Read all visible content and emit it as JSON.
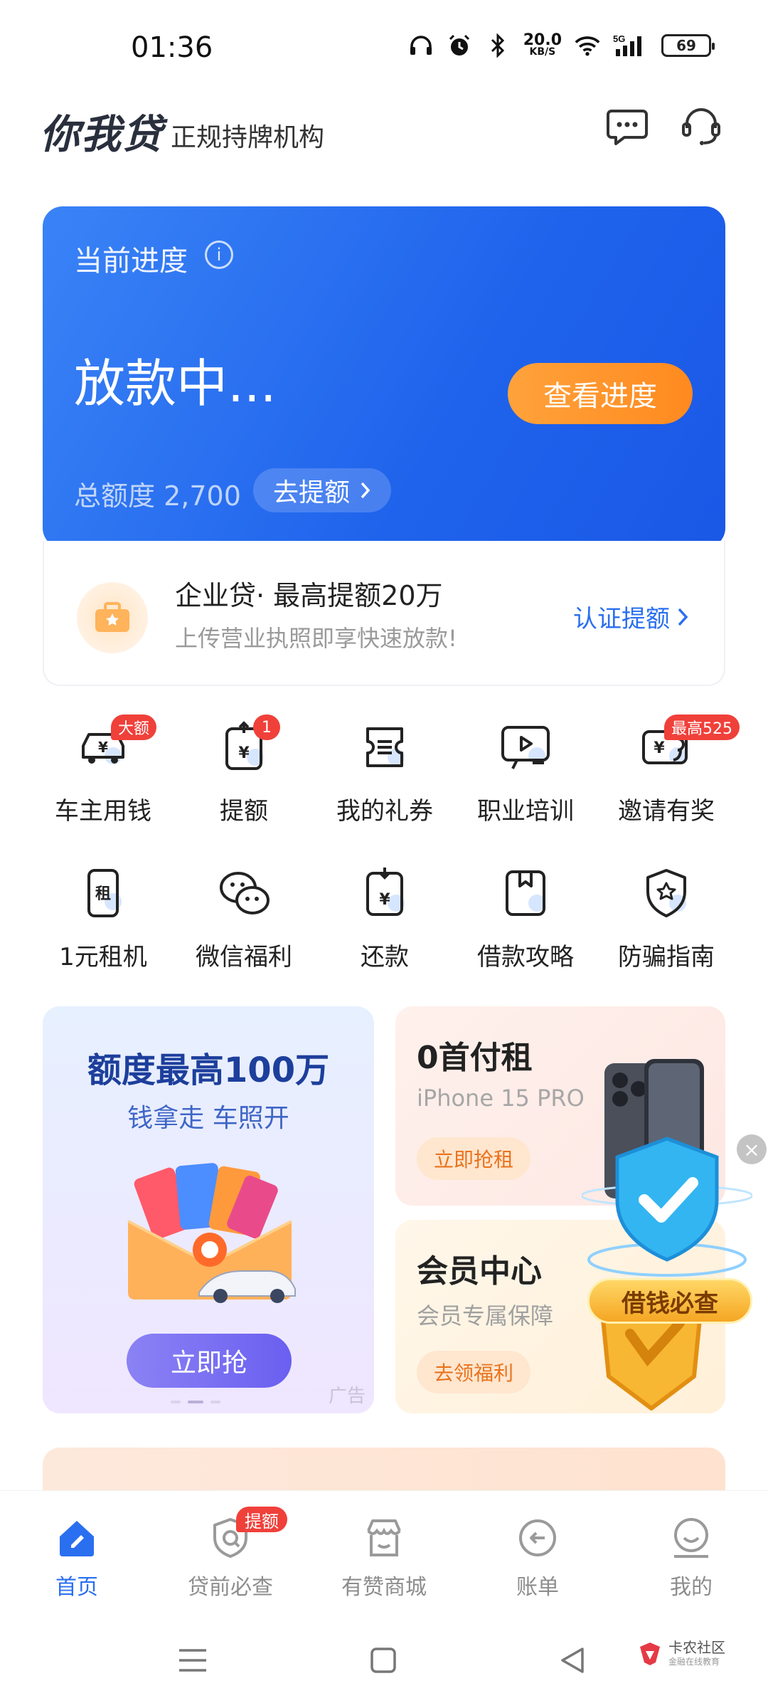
{
  "status_bar": {
    "time": "01:36",
    "net_speed_value": "20.0",
    "net_speed_unit": "KB/S",
    "network": "5G",
    "battery": "69",
    "icons": [
      "headphones-icon",
      "alarm-icon",
      "bluetooth-icon",
      "wifi-icon",
      "signal-icon",
      "battery-icon"
    ]
  },
  "header": {
    "logo": "你我贷",
    "slogan": "正规持牌机构",
    "icons": [
      "message-icon",
      "customer-service-icon"
    ]
  },
  "progress_card": {
    "title": "当前进度",
    "status": "放款中...",
    "button": "查看进度",
    "total_label": "总额度 2,700",
    "raise_button": "去提额"
  },
  "enterprise": {
    "title": "企业贷· 最高提额20万",
    "subtitle": "上传营业执照即享快速放款!",
    "link": "认证提额"
  },
  "grid_items": [
    {
      "label": "车主用钱",
      "badge": "大额",
      "icon": "car-yen-icon"
    },
    {
      "label": "提额",
      "badge": "1",
      "icon": "raise-yen-icon"
    },
    {
      "label": "我的礼券",
      "badge": "",
      "icon": "coupon-icon"
    },
    {
      "label": "职业培训",
      "badge": "",
      "icon": "training-screen-icon"
    },
    {
      "label": "邀请有奖",
      "badge": "最高525",
      "icon": "invite-yen-icon"
    },
    {
      "label": "1元租机",
      "badge": "",
      "icon": "rent-phone-icon"
    },
    {
      "label": "微信福利",
      "badge": "",
      "icon": "wechat-icon"
    },
    {
      "label": "还款",
      "badge": "",
      "icon": "repay-yen-icon"
    },
    {
      "label": "借款攻略",
      "badge": "",
      "icon": "guide-book-icon"
    },
    {
      "label": "防骗指南",
      "badge": "",
      "icon": "shield-star-icon"
    }
  ],
  "promo": {
    "left_title": "额度最高100万",
    "left_subtitle": "钱拿走 车照开",
    "left_button": "立即抢",
    "left_ad": "广告",
    "right_top_title": "0首付租",
    "right_top_subtitle": "iPhone 15 PRO",
    "right_top_chip": "立即抢租",
    "right_bottom_title": "会员中心",
    "right_bottom_subtitle": "会员专属保障",
    "right_bottom_chip": "去领福利",
    "float_label": "借钱必查"
  },
  "tabs": [
    {
      "label": "首页",
      "icon": "home-icon"
    },
    {
      "label": "贷前必查",
      "icon": "check-shield-icon",
      "badge": "提额"
    },
    {
      "label": "有赞商城",
      "icon": "store-icon"
    },
    {
      "label": "账单",
      "icon": "bill-icon"
    },
    {
      "label": "我的",
      "icon": "profile-icon"
    }
  ],
  "watermark": {
    "text": "卡农社区",
    "sub": "金融在线教育"
  },
  "colors": {
    "primary_blue": "#1f63ec",
    "accent_orange": "#ff8a1f",
    "badge_red": "#f0403a",
    "link_blue": "#2a6ff0"
  }
}
